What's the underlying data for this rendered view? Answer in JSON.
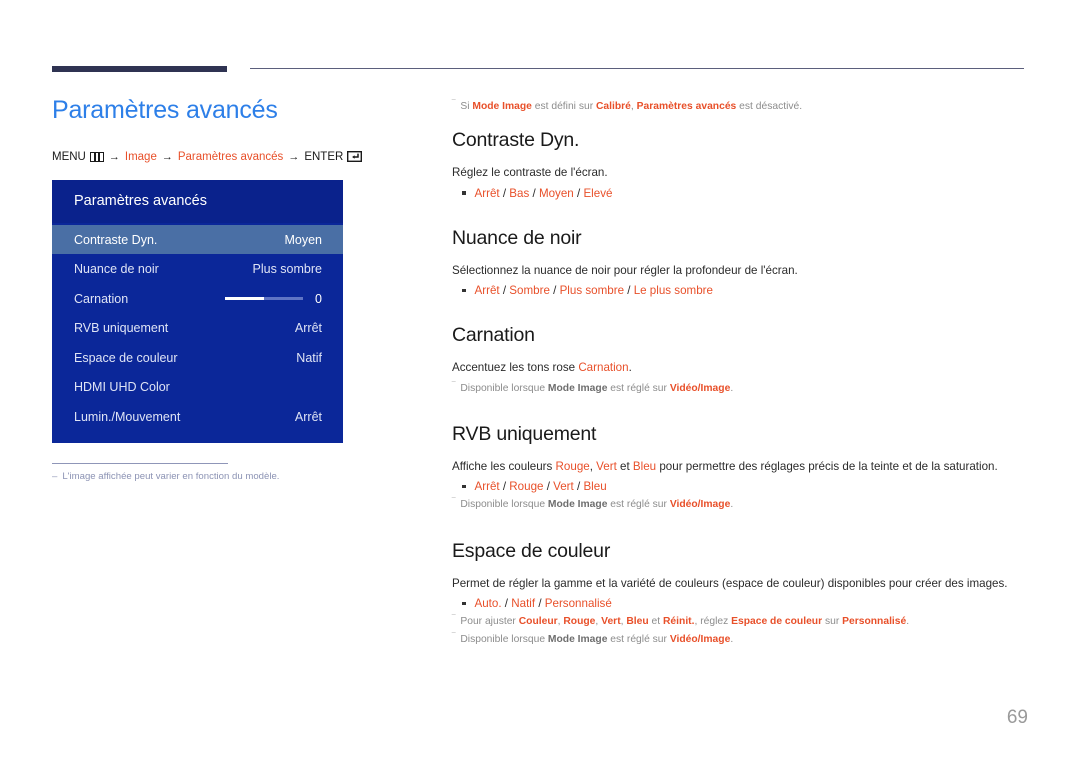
{
  "page": {
    "number": "69",
    "title": "Paramètres avancés"
  },
  "breadcrumb": {
    "menu_label": "MENU",
    "menu_icon": "menu-grid-icon",
    "arrow": "→",
    "item1": "Image",
    "item2": "Paramètres avancés",
    "enter_label": "ENTER",
    "enter_icon": "enter-return-icon"
  },
  "osd": {
    "header": "Paramètres avancés",
    "rows": [
      {
        "label": "Contraste Dyn.",
        "value": "Moyen",
        "selected": true,
        "type": "value"
      },
      {
        "label": "Nuance de noir",
        "value": "Plus sombre",
        "selected": false,
        "type": "value"
      },
      {
        "label": "Carnation",
        "value": "0",
        "selected": false,
        "type": "slider",
        "slider_percent": 50
      },
      {
        "label": "RVB uniquement",
        "value": "Arrêt",
        "selected": false,
        "type": "value"
      },
      {
        "label": "Espace de couleur",
        "value": "Natif",
        "selected": false,
        "type": "value"
      },
      {
        "label": "HDMI UHD Color",
        "value": "",
        "selected": false,
        "type": "value"
      },
      {
        "label": "Lumin./Mouvement",
        "value": "Arrêt",
        "selected": false,
        "type": "value"
      }
    ],
    "footnote": {
      "mark": "–",
      "text": "L'image affichée peut varier en fonction du modèle."
    }
  },
  "content": {
    "intro_note": {
      "mark": "‾",
      "p1": "Si ",
      "b1": "Mode Image",
      "p2": " est défini sur ",
      "b2": "Calibré",
      "p3": ", ",
      "b3": "Paramètres avancés",
      "p4": " est désactivé."
    },
    "sections": [
      {
        "heading": "Contraste Dyn.",
        "desc": "Réglez le contraste de l'écran.",
        "options": [
          "Arrêt",
          "Bas",
          "Moyen",
          "Elevé"
        ]
      },
      {
        "heading": "Nuance de noir",
        "desc": "Sélectionnez la nuance de noir pour régler la profondeur de l'écran.",
        "options": [
          "Arrêt",
          "Sombre",
          "Plus sombre",
          "Le plus sombre"
        ]
      },
      {
        "heading": "Carnation",
        "desc_pre": "Accentuez les tons rose ",
        "desc_em": "Carnation",
        "desc_post": ".",
        "note": {
          "mark": "‾",
          "p1": "Disponible lorsque ",
          "b1": "Mode Image",
          "p2": " est réglé sur ",
          "b2": "Vidéo/Image",
          "p3": "."
        }
      },
      {
        "heading": "RVB uniquement",
        "desc_pre": "Affiche les couleurs ",
        "desc_c1": "Rouge",
        "desc_mid1": ", ",
        "desc_c2": "Vert",
        "desc_mid2": " et ",
        "desc_c3": "Bleu",
        "desc_post": " pour permettre des réglages précis de la teinte et de la saturation.",
        "options": [
          "Arrêt",
          "Rouge",
          "Vert",
          "Bleu"
        ],
        "note": {
          "mark": "‾",
          "p1": "Disponible lorsque ",
          "b1": "Mode Image",
          "p2": " est réglé sur ",
          "b2": "Vidéo/Image",
          "p3": "."
        }
      },
      {
        "heading": "Espace de couleur",
        "desc": "Permet de régler la gamme et la variété de couleurs (espace de couleur) disponibles pour créer des images.",
        "options": [
          "Auto.",
          "Natif",
          "Personnalisé"
        ],
        "note1": {
          "mark": "‾",
          "p1": "Pour ajuster ",
          "b1": "Couleur",
          "p2": ", ",
          "b2": "Rouge",
          "p3": ", ",
          "b3": "Vert",
          "p4": ", ",
          "b4": "Bleu",
          "p5": " et ",
          "b5": "Réinit.",
          "p6": ", réglez ",
          "b6": "Espace de couleur",
          "p7": " sur ",
          "b7": "Personnalisé",
          "p8": "."
        },
        "note2": {
          "mark": "‾",
          "p1": "Disponible lorsque ",
          "b1": "Mode Image",
          "p2": " est réglé sur ",
          "b2": "Vidéo/Image",
          "p3": "."
        }
      }
    ]
  },
  "colors": {
    "title_blue": "#2d7fe8",
    "accent_orange": "#e8502a",
    "osd_blue": "#0b2799",
    "osd_header_blue": "#0a228c",
    "osd_selected": "#4a6fa5",
    "rule_navy": "#2f3352"
  }
}
